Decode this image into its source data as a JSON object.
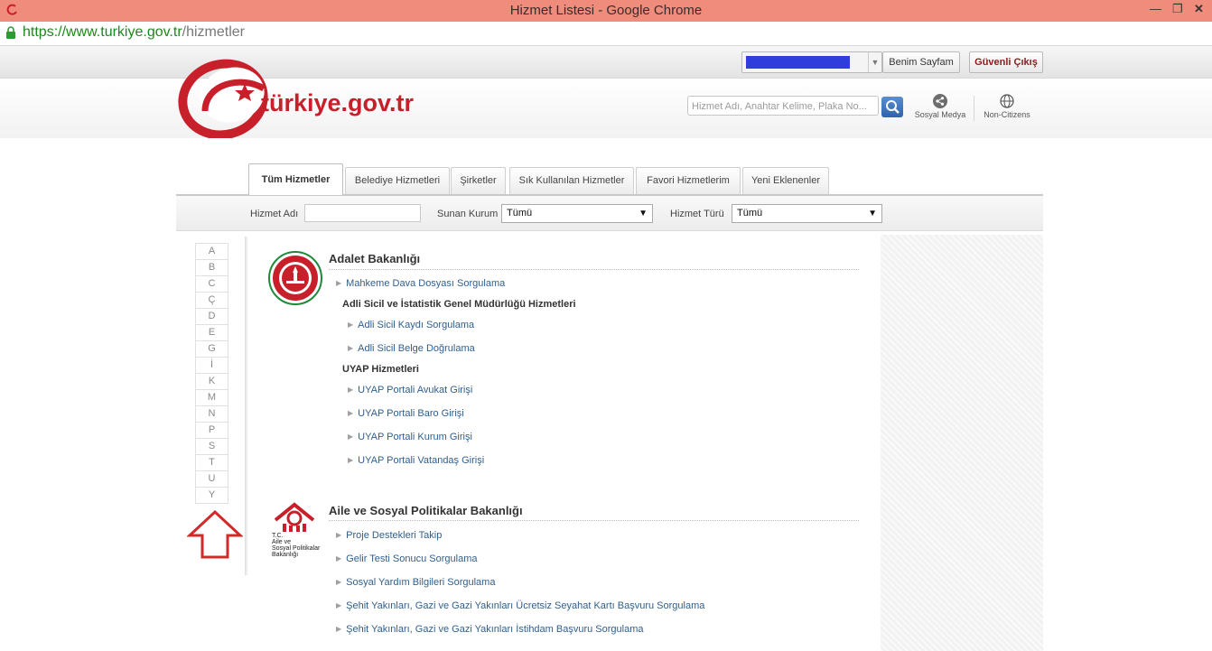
{
  "window": {
    "title": "Hizmet Listesi - Google Chrome",
    "url_host": "https://www.turkiye.gov.tr",
    "url_path": "/hizmetler"
  },
  "topbar": {
    "benim_sayfam": "Benim Sayfam",
    "guvenli_cikis": "Güvenli Çıkış"
  },
  "header": {
    "logo_text": "türkiye.gov.tr",
    "search_placeholder": "Hizmet Adı, Anahtar Kelime, Plaka No...",
    "social_label": "Sosyal Medya",
    "noncitizens_label": "Non-Citizens"
  },
  "tabs": [
    {
      "label": "Tüm Hizmetler",
      "active": true
    },
    {
      "label": "Belediye Hizmetleri",
      "active": false
    },
    {
      "label": "Şirketler",
      "active": false
    },
    {
      "label": "Sık Kullanılan Hizmetler",
      "active": false
    },
    {
      "label": "Favori Hizmetlerim",
      "active": false
    },
    {
      "label": "Yeni Eklenenler",
      "active": false
    }
  ],
  "filters": {
    "hizmet_adi_label": "Hizmet Adı",
    "hizmet_adi_value": "",
    "sunan_kurum_label": "Sunan Kurum",
    "sunan_kurum_value": "Tümü",
    "hizmet_turu_label": "Hizmet Türü",
    "hizmet_turu_value": "Tümü"
  },
  "letters": [
    "A",
    "B",
    "C",
    "Ç",
    "D",
    "E",
    "G",
    "İ",
    "K",
    "M",
    "N",
    "P",
    "S",
    "T",
    "U",
    "Y"
  ],
  "sections": {
    "adalet": {
      "title": "Adalet Bakanlığı",
      "links": [
        "Mahkeme Dava Dosyası Sorgulama"
      ],
      "sub1_title": "Adli Sicil ve İstatistik Genel Müdürlüğü Hizmetleri",
      "sub1_links": [
        "Adli Sicil Kaydı Sorgulama",
        "Adli Sicil Belge Doğrulama"
      ],
      "sub2_title": "UYAP Hizmetleri",
      "sub2_links": [
        "UYAP Portali Avukat Girişi",
        "UYAP Portali Baro Girişi",
        "UYAP Portali Kurum Girişi",
        "UYAP Portali Vatandaş Girişi"
      ]
    },
    "aile": {
      "title": "Aile ve Sosyal Politikalar Bakanlığı",
      "emblem_lines": [
        "T.C.",
        "Aile ve",
        "Sosyal Politikalar",
        "Bakanlığı"
      ],
      "links": [
        "Proje Destekleri Takip",
        "Gelir Testi Sonucu Sorgulama",
        "Sosyal Yardım Bilgileri Sorgulama",
        "Şehit Yakınları, Gazi ve Gazi Yakınları Ücretsiz Seyahat Kartı Başvuru Sorgulama",
        "Şehit Yakınları, Gazi ve Gazi Yakınları İstihdam Başvuru Sorgulama"
      ]
    }
  },
  "colors": {
    "titlebar": "#f08c7c",
    "brand_red": "#c8202a",
    "link": "#2f5f8f",
    "url_green": "#1a8a1a"
  }
}
